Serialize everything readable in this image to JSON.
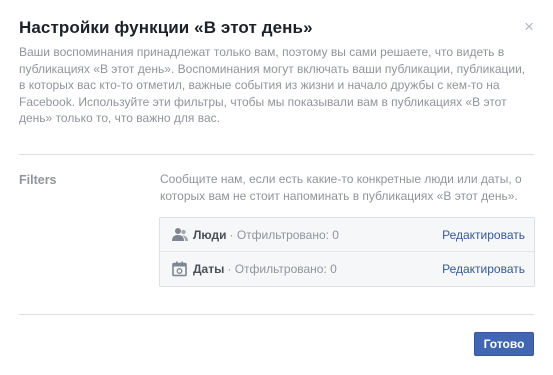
{
  "dialog": {
    "title": "Настройки функции «В этот день»",
    "close_glyph": "×",
    "description": "Ваши воспоминания принадлежат только вам, поэтому вы сами решаете, что видеть в публикациях «В этот день». Воспоминания могут включать ваши публикации, публикации, в которых вас кто-то отметил, важные события из жизни и начало дружбы с кем-то на Facebook. Используйте эти фильтры, чтобы мы показывали вам в публикациях «В этот день» только то, что важно для вас."
  },
  "filters": {
    "label": "Filters",
    "description": "Сообщите нам, если есть какие-то конкретные люди или даты, о которых вам не стоит напоминать в публикациях «В этот день».",
    "rows": [
      {
        "icon": "people-icon",
        "name": "Люди",
        "meta": "· Отфильтровано: 0",
        "edit": "Редактировать"
      },
      {
        "icon": "calendar-icon",
        "name": "Даты",
        "meta": "· Отфильтровано: 0",
        "edit": "Редактировать"
      }
    ]
  },
  "footer": {
    "done_label": "Готово"
  },
  "colors": {
    "accent": "#4267b2",
    "link": "#365899",
    "muted": "#90949c"
  }
}
